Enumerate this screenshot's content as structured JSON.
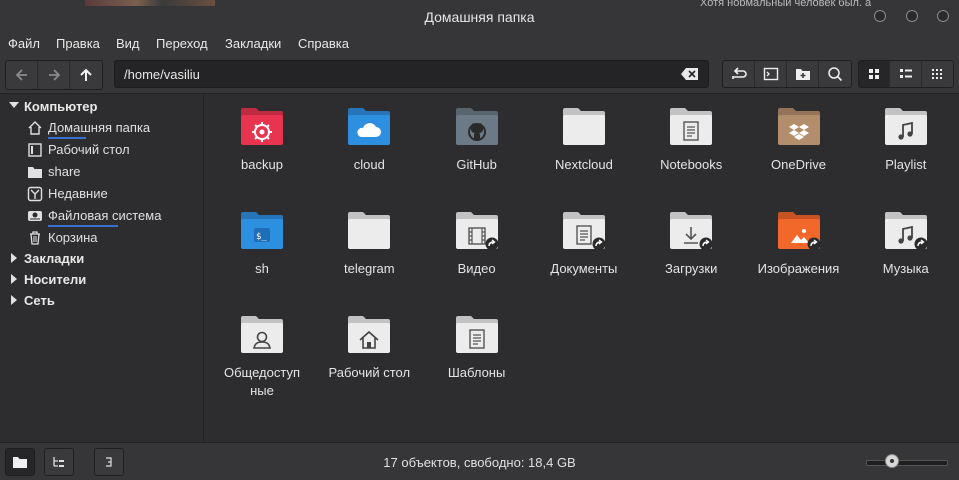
{
  "window": {
    "title": "Домашняя папка",
    "background_snippet": "Хотя нормальный человек был, а"
  },
  "menu": [
    "Файл",
    "Правка",
    "Вид",
    "Переход",
    "Закладки",
    "Справка"
  ],
  "toolbar": {
    "path": "/home/vasiliu",
    "back_icon": "arrow-left-icon",
    "forward_icon": "arrow-right-icon",
    "up_icon": "arrow-up-icon"
  },
  "sidebar": {
    "computer_header": "Компьютер",
    "places": [
      {
        "label": "Домашняя папка",
        "icon": "home-icon"
      },
      {
        "label": "Рабочий стол",
        "icon": "desktop-icon"
      },
      {
        "label": "share",
        "icon": "folder-icon"
      },
      {
        "label": "Недавние",
        "icon": "recent-icon"
      },
      {
        "label": "Файловая система",
        "icon": "drive-icon"
      },
      {
        "label": "Корзина",
        "icon": "trash-icon"
      }
    ],
    "bookmarks_header": "Закладки",
    "devices_header": "Носители",
    "network_header": "Сеть"
  },
  "files": [
    {
      "name": "backup",
      "color": "#e8344e",
      "emblem": "gear"
    },
    {
      "name": "cloud",
      "color": "#2d8fe0",
      "emblem": "cloud"
    },
    {
      "name": "GitHub",
      "color": "#6b7a86",
      "emblem": "github"
    },
    {
      "name": "Nextcloud",
      "color": "#ececec",
      "emblem": "none"
    },
    {
      "name": "Notebooks",
      "color": "#ececec",
      "emblem": "doc"
    },
    {
      "name": "OneDrive",
      "color": "#b38e6c",
      "emblem": "dropbox"
    },
    {
      "name": "Playlist",
      "color": "#ececec",
      "emblem": "music"
    },
    {
      "name": "sh",
      "color": "#2d8fe0",
      "emblem": "terminal"
    },
    {
      "name": "telegram",
      "color": "#ececec",
      "emblem": "none"
    },
    {
      "name": "Видео",
      "color": "#ececec",
      "emblem": "film"
    },
    {
      "name": "Документы",
      "color": "#ececec",
      "emblem": "doc"
    },
    {
      "name": "Загрузки",
      "color": "#ececec",
      "emblem": "download"
    },
    {
      "name": "Изображения",
      "color": "#f2672a",
      "emblem": "image"
    },
    {
      "name": "Музыка",
      "color": "#ececec",
      "emblem": "music"
    },
    {
      "name": "Общедоступные",
      "color": "#ececec",
      "emblem": "user"
    },
    {
      "name": "Рабочий стол",
      "color": "#ececec",
      "emblem": "home"
    },
    {
      "name": "Шаблоны",
      "color": "#ececec",
      "emblem": "doc"
    }
  ],
  "file_names_wrapped": {
    "Общедоступные": [
      "Общедоступ",
      "ные"
    ]
  },
  "status": {
    "text": "17 объектов, свободно: 18,4 GB"
  }
}
